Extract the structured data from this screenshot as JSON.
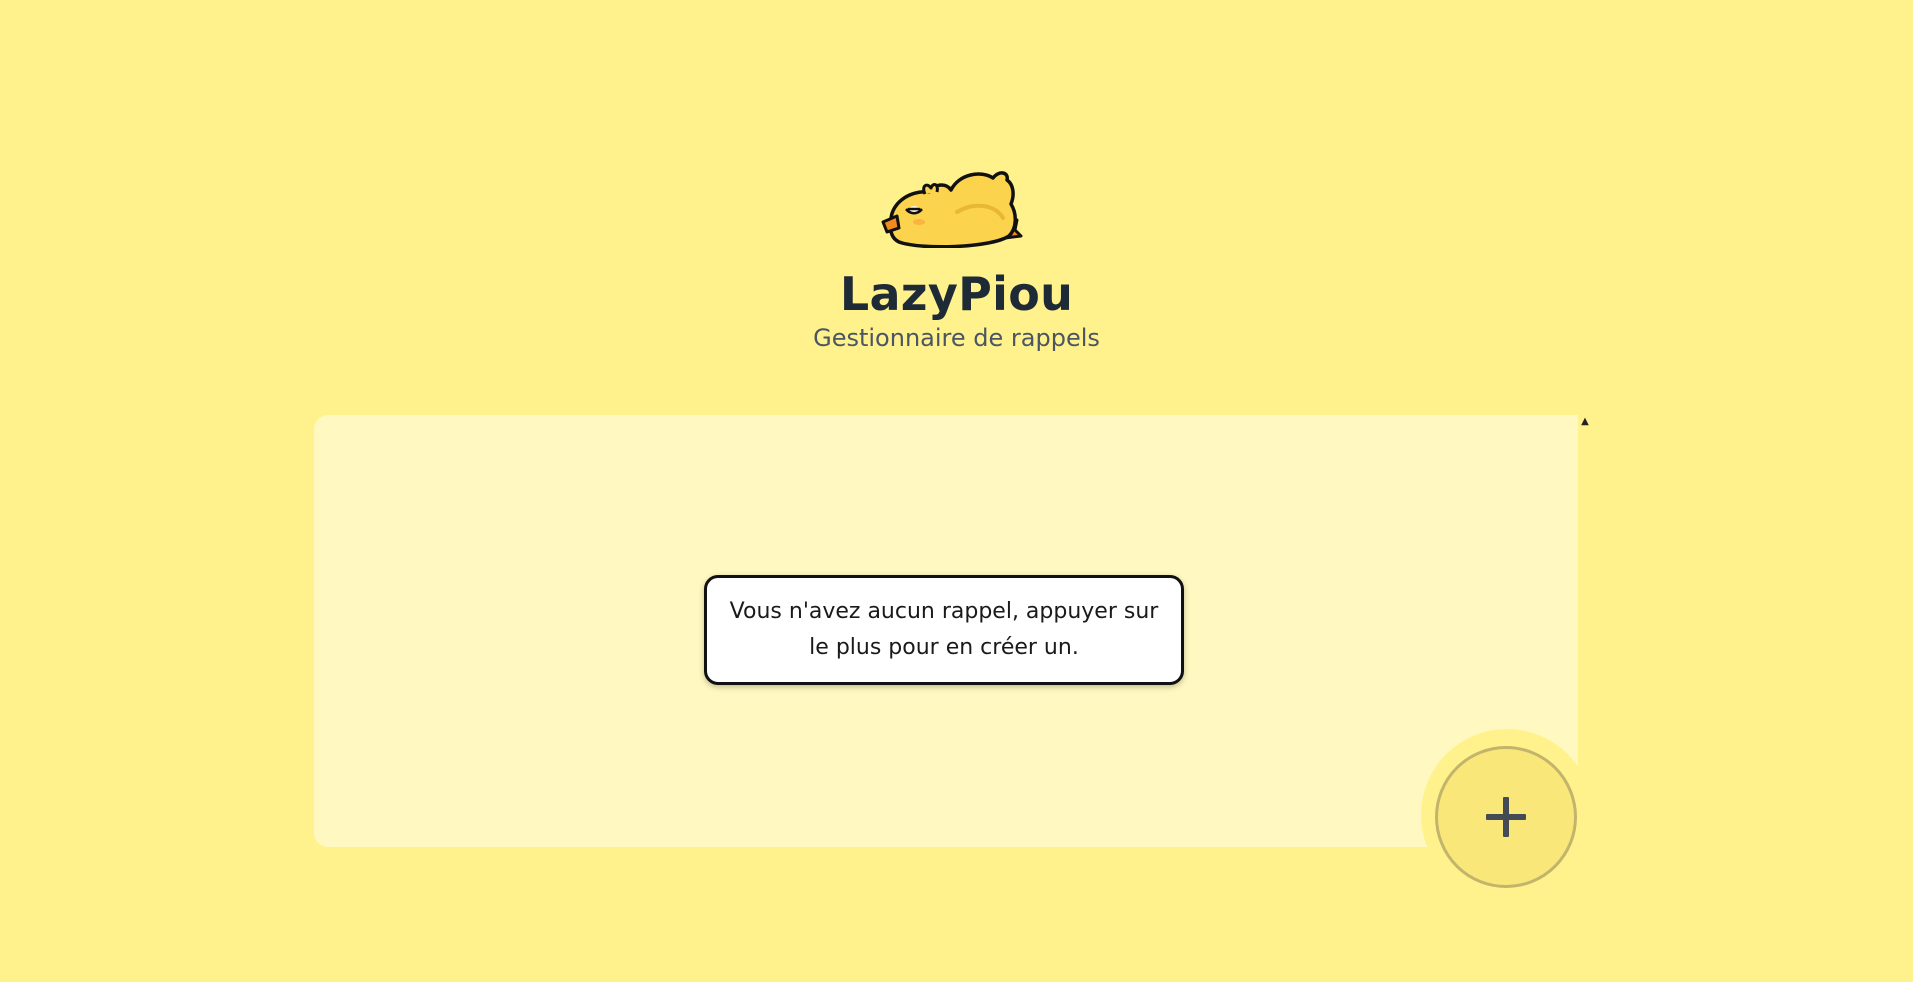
{
  "header": {
    "logo_icon": "sleeping-chick-logo",
    "title": "LazyPiou",
    "subtitle": "Gestionnaire de rappels"
  },
  "reminders": {
    "items": [],
    "empty_message": "Vous n'avez aucun rappel, appuyer sur le plus pour en créer un."
  },
  "add_button": {
    "icon": "plus-icon"
  },
  "scrollbar": {
    "up_arrow": "▲",
    "down_arrow": "⌄"
  },
  "colors": {
    "background": "#fff28c",
    "panel": "#fff8c0",
    "title": "#1f2a37",
    "subtitle": "#4b5563",
    "fab": "#f9e77a"
  }
}
